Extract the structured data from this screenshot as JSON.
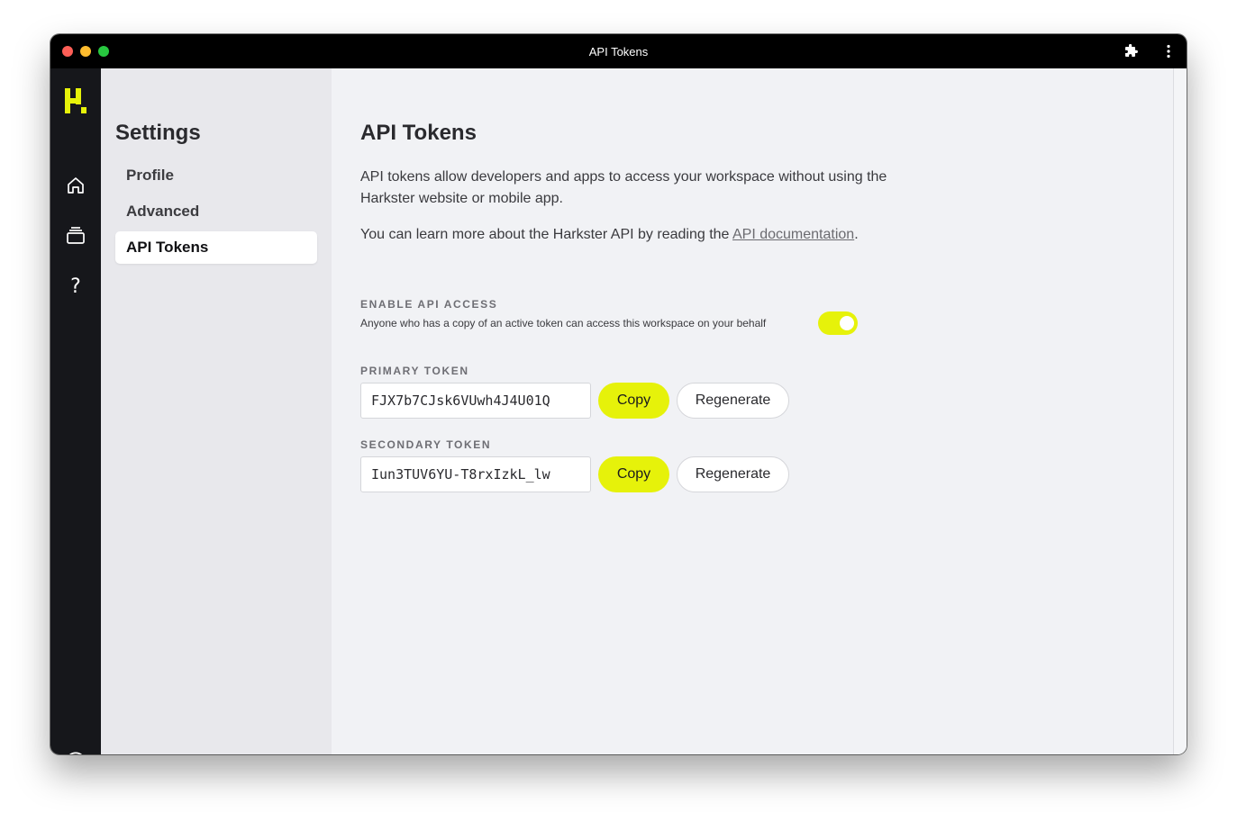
{
  "window": {
    "title": "API Tokens"
  },
  "titlebar": {
    "icons": [
      "extension-puzzle-icon",
      "more-vertical-icon"
    ]
  },
  "rail": {
    "logo": "harkster-logo",
    "items": [
      "home-icon",
      "inbox-stack-icon",
      "help-icon",
      "account-icon"
    ],
    "help_glyph": "?"
  },
  "sidebar": {
    "title": "Settings",
    "items": [
      {
        "label": "Profile"
      },
      {
        "label": "Advanced"
      },
      {
        "label": "API Tokens",
        "active": true
      }
    ]
  },
  "main": {
    "title": "API Tokens",
    "intro": "API tokens allow developers and apps to access your workspace without using the Harkster website or mobile app.",
    "learn_more_prefix": "You can learn more about the Harkster API by reading the ",
    "learn_more_link": "API documentation",
    "learn_more_suffix": ".",
    "enable": {
      "label": "ENABLE API ACCESS",
      "hint": "Anyone who has a copy of an active token can access this workspace on your behalf",
      "enabled": true
    },
    "primary": {
      "label": "PRIMARY TOKEN",
      "value": "FJX7b7CJsk6VUwh4J4U01Q",
      "copy_label": "Copy",
      "regen_label": "Regenerate"
    },
    "secondary": {
      "label": "SECONDARY TOKEN",
      "value": "Iun3TUV6YU-T8rxIzkL_lw",
      "copy_label": "Copy",
      "regen_label": "Regenerate"
    }
  },
  "colors": {
    "accent": "#e6f20a",
    "rail_bg": "#16171b",
    "sidebar_bg": "#e8e8ec",
    "main_bg": "#f1f2f5"
  }
}
